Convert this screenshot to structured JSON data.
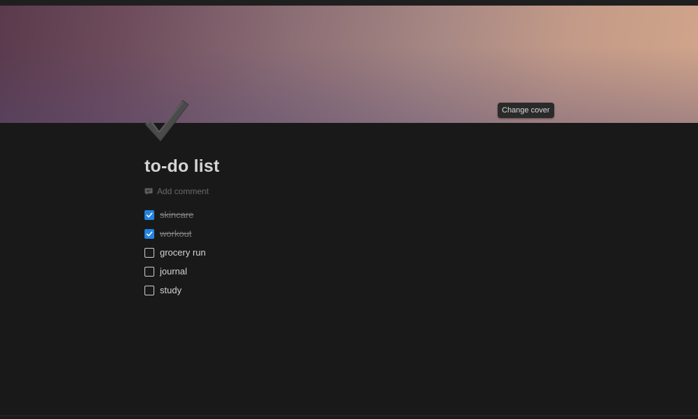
{
  "cover": {
    "change_cover_label": "Change cover"
  },
  "page": {
    "icon": "checkmark-icon",
    "title": "to-do list",
    "add_comment_label": "Add comment"
  },
  "todos": [
    {
      "label": "skincare",
      "checked": true
    },
    {
      "label": "workout",
      "checked": true
    },
    {
      "label": "grocery run",
      "checked": false
    },
    {
      "label": "journal",
      "checked": false
    },
    {
      "label": "study",
      "checked": false
    }
  ],
  "colors": {
    "background": "#191919",
    "checkbox_checked": "#2383e2",
    "text": "#d4d4d4",
    "muted_text": "#6a6a6a"
  }
}
